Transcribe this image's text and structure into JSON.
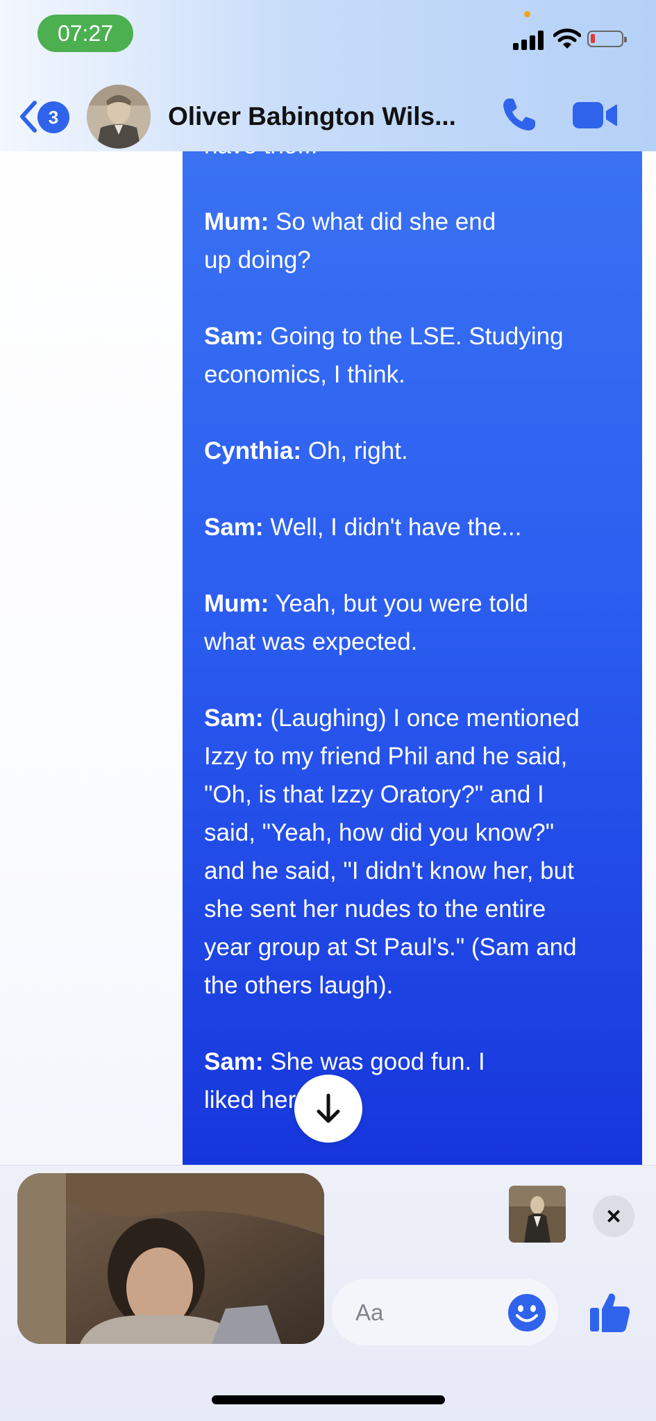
{
  "status_bar": {
    "time": "07:27"
  },
  "header": {
    "back_badge_count": "3",
    "contact_name": "Oliver Babington Wils..."
  },
  "messages": [
    {
      "text": "have the..."
    },
    {
      "speaker": "Mum:",
      "text": " So what did she end"
    },
    {
      "text": "up doing?"
    },
    {
      "speaker": "Sam:",
      "text": " Going to the LSE. Studying"
    },
    {
      "text": "economics, I think."
    },
    {
      "speaker": "Cynthia:",
      "text": " Oh, right."
    },
    {
      "speaker": "Sam:",
      "text": " Well, I didn't have the..."
    },
    {
      "speaker": "Mum:",
      "text": " Yeah, but you were told"
    },
    {
      "text": "what was expected."
    },
    {
      "speaker": "Sam:",
      "text": " (Laughing) I once mentioned"
    },
    {
      "text": "Izzy to my friend Phil and he said,"
    },
    {
      "text": "\"Oh, is that Izzy Oratory?\" and I"
    },
    {
      "text": "said, \"Yeah, how did you know?\""
    },
    {
      "text": "and he said, \"I didn't know her, but"
    },
    {
      "text": "she sent her nudes to the entire"
    },
    {
      "text": "year group at St Paul's.\" (Sam and"
    },
    {
      "text": "the others laugh)."
    },
    {
      "speaker": "Sam:",
      "text": " She was good fun. I"
    },
    {
      "text": "liked her."
    }
  ],
  "composer": {
    "placeholder": "Aa"
  },
  "icons": {
    "back": "chevron-left-icon",
    "call": "phone-icon",
    "video": "video-camera-icon",
    "close": "close-icon",
    "emoji": "emoji-icon",
    "like": "thumbs-up-icon",
    "scroll": "arrow-down-icon"
  },
  "colors": {
    "accent": "#2f63eb",
    "bubble_top": "#3a72f3",
    "bubble_bottom": "#1636dc",
    "status_pill": "#4caf50"
  }
}
